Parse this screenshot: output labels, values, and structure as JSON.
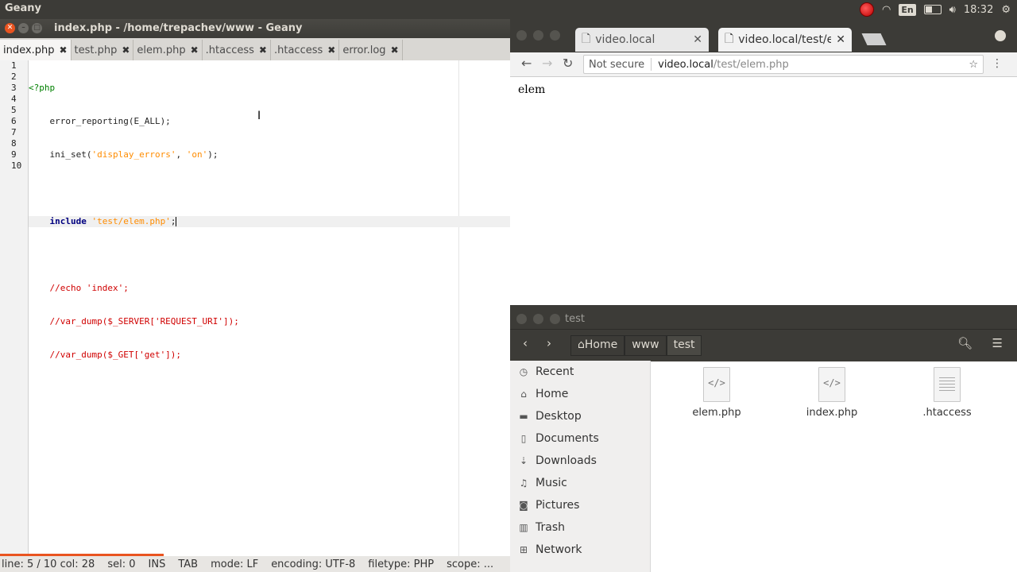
{
  "topbar": {
    "app_name": "Geany",
    "lang": "En",
    "time": "18:32"
  },
  "geany": {
    "title": "index.php - /home/trepachev/www - Geany",
    "tabs": [
      {
        "label": "index.php"
      },
      {
        "label": "test.php"
      },
      {
        "label": "elem.php"
      },
      {
        "label": ".htaccess"
      },
      {
        "label": ".htaccess"
      },
      {
        "label": "error.log"
      }
    ],
    "line_numbers": [
      "1",
      "2",
      "3",
      "4",
      "5",
      "6",
      "7",
      "8",
      "9",
      "10"
    ],
    "code": {
      "l1": "<?php",
      "l2_fn": "    error_reporting(E_ALL);",
      "l3_a": "    ini_set(",
      "l3_s1": "'display_errors'",
      "l3_b": ", ",
      "l3_s2": "'on'",
      "l3_c": ");",
      "l5_kw": "include",
      "l5_s": "'test/elem.php'",
      "l5_end": ";",
      "l7": "    //echo 'index';",
      "l8": "    //var_dump($_SERVER['REQUEST_URI']);",
      "l9": "    //var_dump($_GET['get']);"
    },
    "status": {
      "position": "line: 5 / 10  col: 28",
      "sel": "sel: 0",
      "ins": "INS",
      "tab": "TAB",
      "mode": "mode: LF",
      "encoding": "encoding: UTF-8",
      "filetype": "filetype: PHP",
      "scope": "scope: ..."
    }
  },
  "browser": {
    "tabs": [
      {
        "label": "video.local"
      },
      {
        "label": "video.local/test/ele"
      }
    ],
    "address": {
      "security": "Not secure",
      "host": "video.local",
      "path": "/test/elem.php"
    },
    "content": "elem"
  },
  "files": {
    "title": "test",
    "breadcrumbs": [
      "Home",
      "www",
      "test"
    ],
    "places": [
      {
        "label": "Recent",
        "icon": "clock-icon"
      },
      {
        "label": "Home",
        "icon": "home-icon"
      },
      {
        "label": "Desktop",
        "icon": "folder-icon"
      },
      {
        "label": "Documents",
        "icon": "document-icon"
      },
      {
        "label": "Downloads",
        "icon": "download-icon"
      },
      {
        "label": "Music",
        "icon": "music-icon"
      },
      {
        "label": "Pictures",
        "icon": "camera-icon"
      },
      {
        "label": "Trash",
        "icon": "trash-icon"
      },
      {
        "label": "Network",
        "icon": "network-icon"
      }
    ],
    "items": [
      {
        "name": "elem.php"
      },
      {
        "name": "index.php"
      },
      {
        "name": ".htaccess"
      }
    ]
  },
  "colors": {
    "accent": "#e95420",
    "panel": "#3c3b37"
  }
}
